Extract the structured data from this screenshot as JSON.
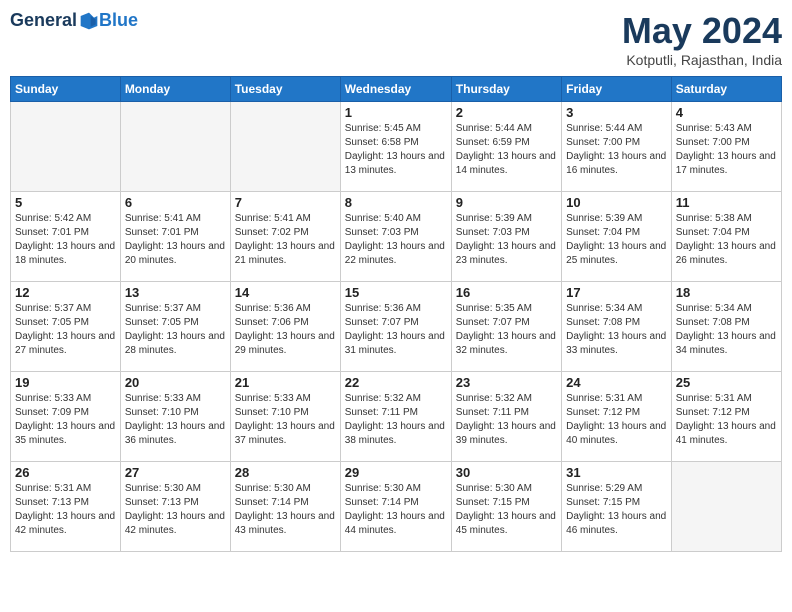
{
  "logo": {
    "general": "General",
    "blue": "Blue"
  },
  "title": "May 2024",
  "location": "Kotputli, Rajasthan, India",
  "days_of_week": [
    "Sunday",
    "Monday",
    "Tuesday",
    "Wednesday",
    "Thursday",
    "Friday",
    "Saturday"
  ],
  "weeks": [
    [
      {
        "day": null
      },
      {
        "day": null
      },
      {
        "day": null
      },
      {
        "day": 1,
        "sunrise": "5:45 AM",
        "sunset": "6:58 PM",
        "daylight": "13 hours and 13 minutes."
      },
      {
        "day": 2,
        "sunrise": "5:44 AM",
        "sunset": "6:59 PM",
        "daylight": "13 hours and 14 minutes."
      },
      {
        "day": 3,
        "sunrise": "5:44 AM",
        "sunset": "7:00 PM",
        "daylight": "13 hours and 16 minutes."
      },
      {
        "day": 4,
        "sunrise": "5:43 AM",
        "sunset": "7:00 PM",
        "daylight": "13 hours and 17 minutes."
      }
    ],
    [
      {
        "day": 5,
        "sunrise": "5:42 AM",
        "sunset": "7:01 PM",
        "daylight": "13 hours and 18 minutes."
      },
      {
        "day": 6,
        "sunrise": "5:41 AM",
        "sunset": "7:01 PM",
        "daylight": "13 hours and 20 minutes."
      },
      {
        "day": 7,
        "sunrise": "5:41 AM",
        "sunset": "7:02 PM",
        "daylight": "13 hours and 21 minutes."
      },
      {
        "day": 8,
        "sunrise": "5:40 AM",
        "sunset": "7:03 PM",
        "daylight": "13 hours and 22 minutes."
      },
      {
        "day": 9,
        "sunrise": "5:39 AM",
        "sunset": "7:03 PM",
        "daylight": "13 hours and 23 minutes."
      },
      {
        "day": 10,
        "sunrise": "5:39 AM",
        "sunset": "7:04 PM",
        "daylight": "13 hours and 25 minutes."
      },
      {
        "day": 11,
        "sunrise": "5:38 AM",
        "sunset": "7:04 PM",
        "daylight": "13 hours and 26 minutes."
      }
    ],
    [
      {
        "day": 12,
        "sunrise": "5:37 AM",
        "sunset": "7:05 PM",
        "daylight": "13 hours and 27 minutes."
      },
      {
        "day": 13,
        "sunrise": "5:37 AM",
        "sunset": "7:05 PM",
        "daylight": "13 hours and 28 minutes."
      },
      {
        "day": 14,
        "sunrise": "5:36 AM",
        "sunset": "7:06 PM",
        "daylight": "13 hours and 29 minutes."
      },
      {
        "day": 15,
        "sunrise": "5:36 AM",
        "sunset": "7:07 PM",
        "daylight": "13 hours and 31 minutes."
      },
      {
        "day": 16,
        "sunrise": "5:35 AM",
        "sunset": "7:07 PM",
        "daylight": "13 hours and 32 minutes."
      },
      {
        "day": 17,
        "sunrise": "5:34 AM",
        "sunset": "7:08 PM",
        "daylight": "13 hours and 33 minutes."
      },
      {
        "day": 18,
        "sunrise": "5:34 AM",
        "sunset": "7:08 PM",
        "daylight": "13 hours and 34 minutes."
      }
    ],
    [
      {
        "day": 19,
        "sunrise": "5:33 AM",
        "sunset": "7:09 PM",
        "daylight": "13 hours and 35 minutes."
      },
      {
        "day": 20,
        "sunrise": "5:33 AM",
        "sunset": "7:10 PM",
        "daylight": "13 hours and 36 minutes."
      },
      {
        "day": 21,
        "sunrise": "5:33 AM",
        "sunset": "7:10 PM",
        "daylight": "13 hours and 37 minutes."
      },
      {
        "day": 22,
        "sunrise": "5:32 AM",
        "sunset": "7:11 PM",
        "daylight": "13 hours and 38 minutes."
      },
      {
        "day": 23,
        "sunrise": "5:32 AM",
        "sunset": "7:11 PM",
        "daylight": "13 hours and 39 minutes."
      },
      {
        "day": 24,
        "sunrise": "5:31 AM",
        "sunset": "7:12 PM",
        "daylight": "13 hours and 40 minutes."
      },
      {
        "day": 25,
        "sunrise": "5:31 AM",
        "sunset": "7:12 PM",
        "daylight": "13 hours and 41 minutes."
      }
    ],
    [
      {
        "day": 26,
        "sunrise": "5:31 AM",
        "sunset": "7:13 PM",
        "daylight": "13 hours and 42 minutes."
      },
      {
        "day": 27,
        "sunrise": "5:30 AM",
        "sunset": "7:13 PM",
        "daylight": "13 hours and 42 minutes."
      },
      {
        "day": 28,
        "sunrise": "5:30 AM",
        "sunset": "7:14 PM",
        "daylight": "13 hours and 43 minutes."
      },
      {
        "day": 29,
        "sunrise": "5:30 AM",
        "sunset": "7:14 PM",
        "daylight": "13 hours and 44 minutes."
      },
      {
        "day": 30,
        "sunrise": "5:30 AM",
        "sunset": "7:15 PM",
        "daylight": "13 hours and 45 minutes."
      },
      {
        "day": 31,
        "sunrise": "5:29 AM",
        "sunset": "7:15 PM",
        "daylight": "13 hours and 46 minutes."
      },
      {
        "day": null
      }
    ]
  ]
}
